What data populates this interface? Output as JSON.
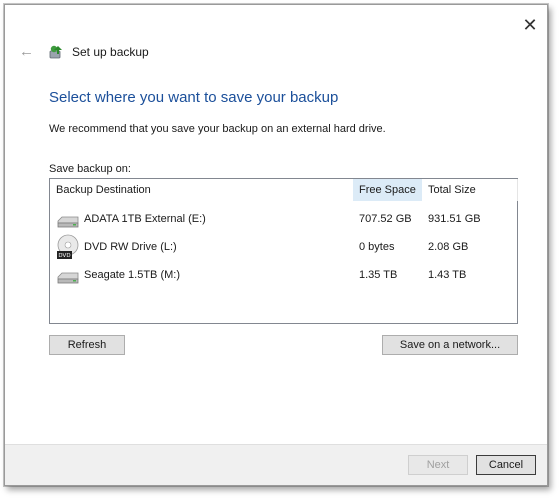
{
  "window": {
    "title": "Set up backup",
    "close_glyph": "✕",
    "back_glyph": "←"
  },
  "content": {
    "heading": "Select where you want to save your backup",
    "recommendation": "We recommend that you save your backup on an external hard drive.",
    "save_label": "Save backup on:"
  },
  "table": {
    "columns": [
      "Backup Destination",
      "Free Space",
      "Total Size"
    ],
    "sorted_column": "Free Space",
    "rows": [
      {
        "icon": "hard-drive-icon",
        "name": "ADATA 1TB External (E:)",
        "free": "707.52 GB",
        "total": "931.51 GB"
      },
      {
        "icon": "dvd-drive-icon",
        "name": "DVD RW Drive (L:)",
        "free": "0 bytes",
        "total": "2.08 GB",
        "icon_label": "DVD"
      },
      {
        "icon": "hard-drive-icon",
        "name": "Seagate 1.5TB (M:)",
        "free": "1.35 TB",
        "total": "1.43 TB"
      }
    ]
  },
  "buttons": {
    "refresh": "Refresh",
    "save_network": "Save on a network...",
    "next": "Next",
    "cancel": "Cancel"
  },
  "colors": {
    "heading": "#1b4f9a",
    "sorted_header": "#dcebf7",
    "footer": "#f0f0f0"
  }
}
